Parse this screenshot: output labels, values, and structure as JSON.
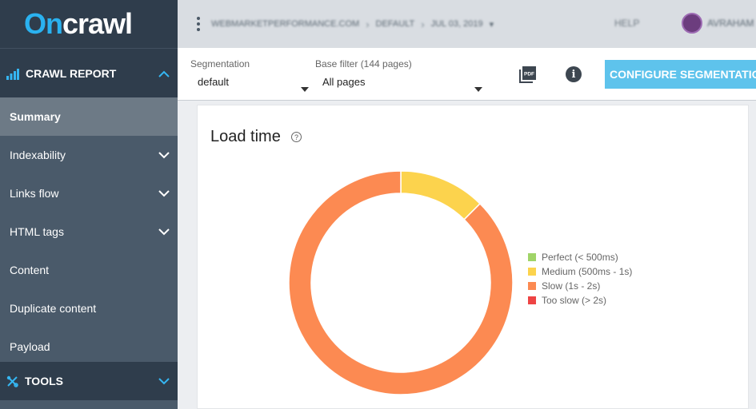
{
  "brand": {
    "logo_on": "On",
    "logo_rest": "crawl"
  },
  "topbar": {
    "crumbs": [
      "WEBMARKETPERFORMANCE.COM",
      "DEFAULT",
      "JUL 03, 2019"
    ],
    "help": "HELP",
    "user": "AVRAHAM"
  },
  "sidebar": {
    "crawl_report": "CRAWL REPORT",
    "items": [
      {
        "label": "Summary"
      },
      {
        "label": "Indexability"
      },
      {
        "label": "Links flow"
      },
      {
        "label": "HTML tags"
      },
      {
        "label": "Content"
      },
      {
        "label": "Duplicate content"
      },
      {
        "label": "Payload"
      }
    ],
    "tools": "TOOLS"
  },
  "filters": {
    "segmentation_label": "Segmentation",
    "segmentation_value": "default",
    "base_filter_label": "Base filter (144 pages)",
    "base_filter_value": "All pages",
    "pdf_icon_text": "PDF",
    "configure_label": "CONFIGURE SEGMENTATION"
  },
  "card": {
    "title": "Load time"
  },
  "chart_data": {
    "type": "pie",
    "title": "Load time",
    "slices": [
      {
        "name": "Perfect (< 500ms)",
        "value": 0,
        "color": "#a0d468"
      },
      {
        "name": "Medium (500ms - 1s)",
        "value": 12.5,
        "color": "#fcd34d"
      },
      {
        "name": "Slow (1s - 2s)",
        "value": 87.5,
        "color": "#fc8a52"
      },
      {
        "name": "Too slow (> 2s)",
        "value": 0,
        "color": "#ee4444"
      }
    ],
    "legend": "right"
  },
  "colors": {
    "accent": "#35b6f2",
    "sidebar": "#4a5a6a",
    "button": "#5ec3ec"
  }
}
